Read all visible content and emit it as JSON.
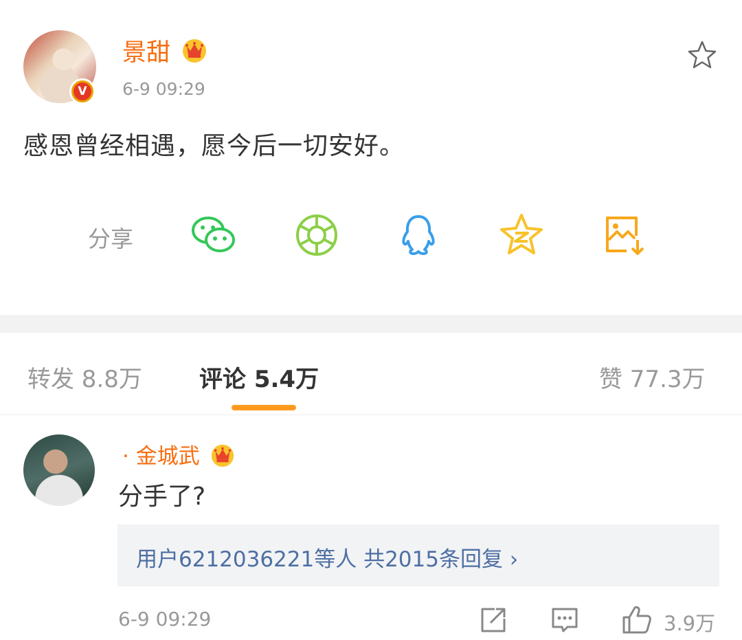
{
  "post": {
    "author": "景甜",
    "verified_badge": "V",
    "time": "6-9 09:29",
    "text": "感恩曾经相遇，愿今后一切安好。"
  },
  "share": {
    "label": "分享",
    "icons": [
      {
        "name": "wechat-icon",
        "color": "#34c759"
      },
      {
        "name": "moments-icon",
        "color": "#8ccf47"
      },
      {
        "name": "qq-icon",
        "color": "#3a9eea"
      },
      {
        "name": "qzone-icon",
        "color": "#f8c22a"
      },
      {
        "name": "save-image-icon",
        "color": "#f7a81b"
      }
    ]
  },
  "tabs": {
    "repost": "转发 8.8万",
    "comments": "评论 5.4万",
    "likes": "赞 77.3万"
  },
  "comment": {
    "author": "· 金城武",
    "text": "分手了?",
    "replies": "用户6212036221等人  共2015条回复 ›",
    "time": "6-9 09:29",
    "like_count": "3.9万"
  },
  "colors": {
    "accent_orange": "#f76d0f",
    "tab_underline": "#ff9a1f",
    "reply_link": "#4e6fa3"
  }
}
